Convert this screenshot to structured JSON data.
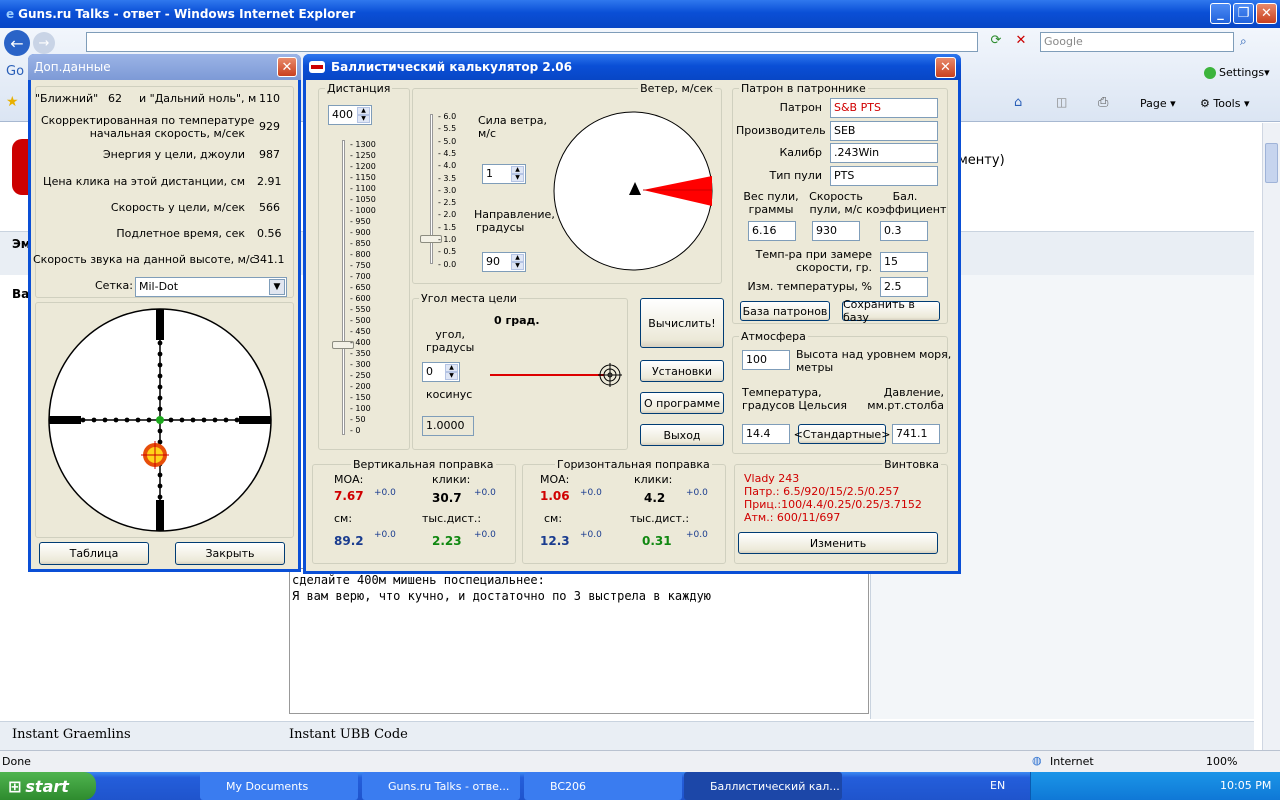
{
  "ie": {
    "title": "Guns.ru Talks - ответ - Windows Internet Explorer",
    "address": "",
    "search_placeholder": "Google",
    "settings": "Settings",
    "page": "Page",
    "tools": "Tools",
    "status": "Done",
    "zone": "Internet",
    "zoom": "100%",
    "right_text": "менту)",
    "sec1": "Эм",
    "sec2": "Ва",
    "instant_graemlins": "Instant Graemlins",
    "instant_ubb": "Instant UBB Code",
    "text_line1": "сделайте 400м мишень поспециальнее:",
    "text_line2": "Я вам верю, что кучно, и достаточно по 3 выстрела в каждую"
  },
  "dop": {
    "title": "Доп.данные",
    "near_label": "\"Ближний\"",
    "near_value": "62",
    "far_label": "и \"Дальний ноль\", м",
    "far_value": "110",
    "corr_label1": "Скорректированная по температуре",
    "corr_label2": "начальная скорость, м/сек",
    "corr_value": "929",
    "energy_label": "Энергия у цели, джоули",
    "energy_value": "987",
    "click_label": "Цена клика на этой дистанции, см",
    "click_value": "2.91",
    "speed_label": "Скорость у цели, м/сек",
    "speed_value": "566",
    "time_label": "Подлетное время, сек",
    "time_value": "0.56",
    "sound_label": "Скорость звука на данной высоте, м/с",
    "sound_value": "341.1",
    "grid_label": "Сетка:",
    "grid_value": "Mil-Dot",
    "table_btn": "Таблица",
    "close_btn": "Закрыть"
  },
  "calc": {
    "title": "Баллистический калькулятор 2.06",
    "distance": {
      "label": "Дистанция",
      "value": "400",
      "ticks": [
        "1300",
        "1250",
        "1200",
        "1150",
        "1100",
        "1050",
        "1000",
        "950",
        "900",
        "850",
        "800",
        "750",
        "700",
        "650",
        "600",
        "550",
        "500",
        "450",
        "400",
        "350",
        "300",
        "250",
        "200",
        "150",
        "100",
        "50",
        "0"
      ]
    },
    "wind": {
      "label": "Ветер, м/сек",
      "force_label1": "Сила ветра,",
      "force_label2": "м/с",
      "force_value": "1",
      "dir_label1": "Направление,",
      "dir_label2": "градусы",
      "dir_value": "90",
      "ticks": [
        "6.0",
        "5.5",
        "5.0",
        "4.5",
        "4.0",
        "3.5",
        "3.0",
        "2.5",
        "2.0",
        "1.5",
        "1.0",
        "0.5",
        "0.0"
      ]
    },
    "angle": {
      "label": "Угол места цели",
      "deg_text": "0 град.",
      "angle_label1": "угол,",
      "angle_label2": "градусы",
      "angle_value": "0",
      "cos_label": "косинус",
      "cos_value": "1.0000"
    },
    "buttons": {
      "compute": "Вычислить!",
      "settings": "Установки",
      "about": "О программе",
      "exit": "Выход"
    },
    "cartridge": {
      "label": "Патрон в патроннике",
      "patron_label": "Патрон",
      "patron_value": "S&B PTS",
      "maker_label": "Производитель",
      "maker_value": "SEB",
      "caliber_label": "Калибр",
      "caliber_value": ".243Win",
      "bullet_label": "Тип пули",
      "bullet_value": "PTS",
      "weight_label1": "Вес пули,",
      "weight_label2": "граммы",
      "weight_value": "6.16",
      "speed_label1": "Скорость",
      "speed_label2": "пули, м/с",
      "speed_value": "930",
      "bc_label1": "Бал.",
      "bc_label2": "коэффициент",
      "bc_value": "0.3",
      "temp_label1": "Темп-ра при замере",
      "temp_label2": "скорости, гр.",
      "temp_value": "15",
      "change_label": "Изм. температуры, %",
      "change_value": "2.5",
      "base_btn": "База патронов",
      "save_btn": "Сохранить в базу"
    },
    "atmo": {
      "label": "Атмосфера",
      "alt_value": "100",
      "alt_label1": "Высота над уровнем моря,",
      "alt_label2": "метры",
      "temp_label1": "Температура,",
      "temp_label2": "градусов Цельсия",
      "press_label1": "Давление,",
      "press_label2": "мм.рт.столба",
      "temp_value": "14.4",
      "std_btn": "<Стандартные>",
      "press_value": "741.1"
    },
    "vert": {
      "label": "Вертикальная поправка",
      "moa_label": "МОА:",
      "moa": "7.67",
      "moa_d": "+0.0",
      "clicks_label": "клики:",
      "clicks": "30.7",
      "clicks_d": "+0.0",
      "cm_label": "см:",
      "cm": "89.2",
      "cm_d": "+0.0",
      "mil_label": "тыс.дист.:",
      "mil": "2.23",
      "mil_d": "+0.0"
    },
    "horiz": {
      "label": "Горизонтальная поправка",
      "moa_label": "МОА:",
      "moa": "1.06",
      "moa_d": "+0.0",
      "clicks_label": "клики:",
      "clicks": "4.2",
      "clicks_d": "+0.0",
      "cm_label": "см:",
      "cm": "12.3",
      "cm_d": "+0.0",
      "mil_label": "тыс.дист.:",
      "mil": "0.31",
      "mil_d": "+0.0"
    },
    "rifle": {
      "label": "Винтовка",
      "line1": "Vlady 243",
      "line2": "Патр.: 6.5/920/15/2.5/0.257",
      "line3": "Приц.:100/4.4/0.25/0.25/3.7152",
      "line4": "Атм.:  600/11/697",
      "change_btn": "Изменить"
    }
  },
  "taskbar": {
    "start": "start",
    "items": [
      "My Documents",
      "Guns.ru Talks - отве...",
      "BC206",
      "Баллистический кал..."
    ],
    "lang": "EN",
    "clock": "10:05 PM"
  }
}
